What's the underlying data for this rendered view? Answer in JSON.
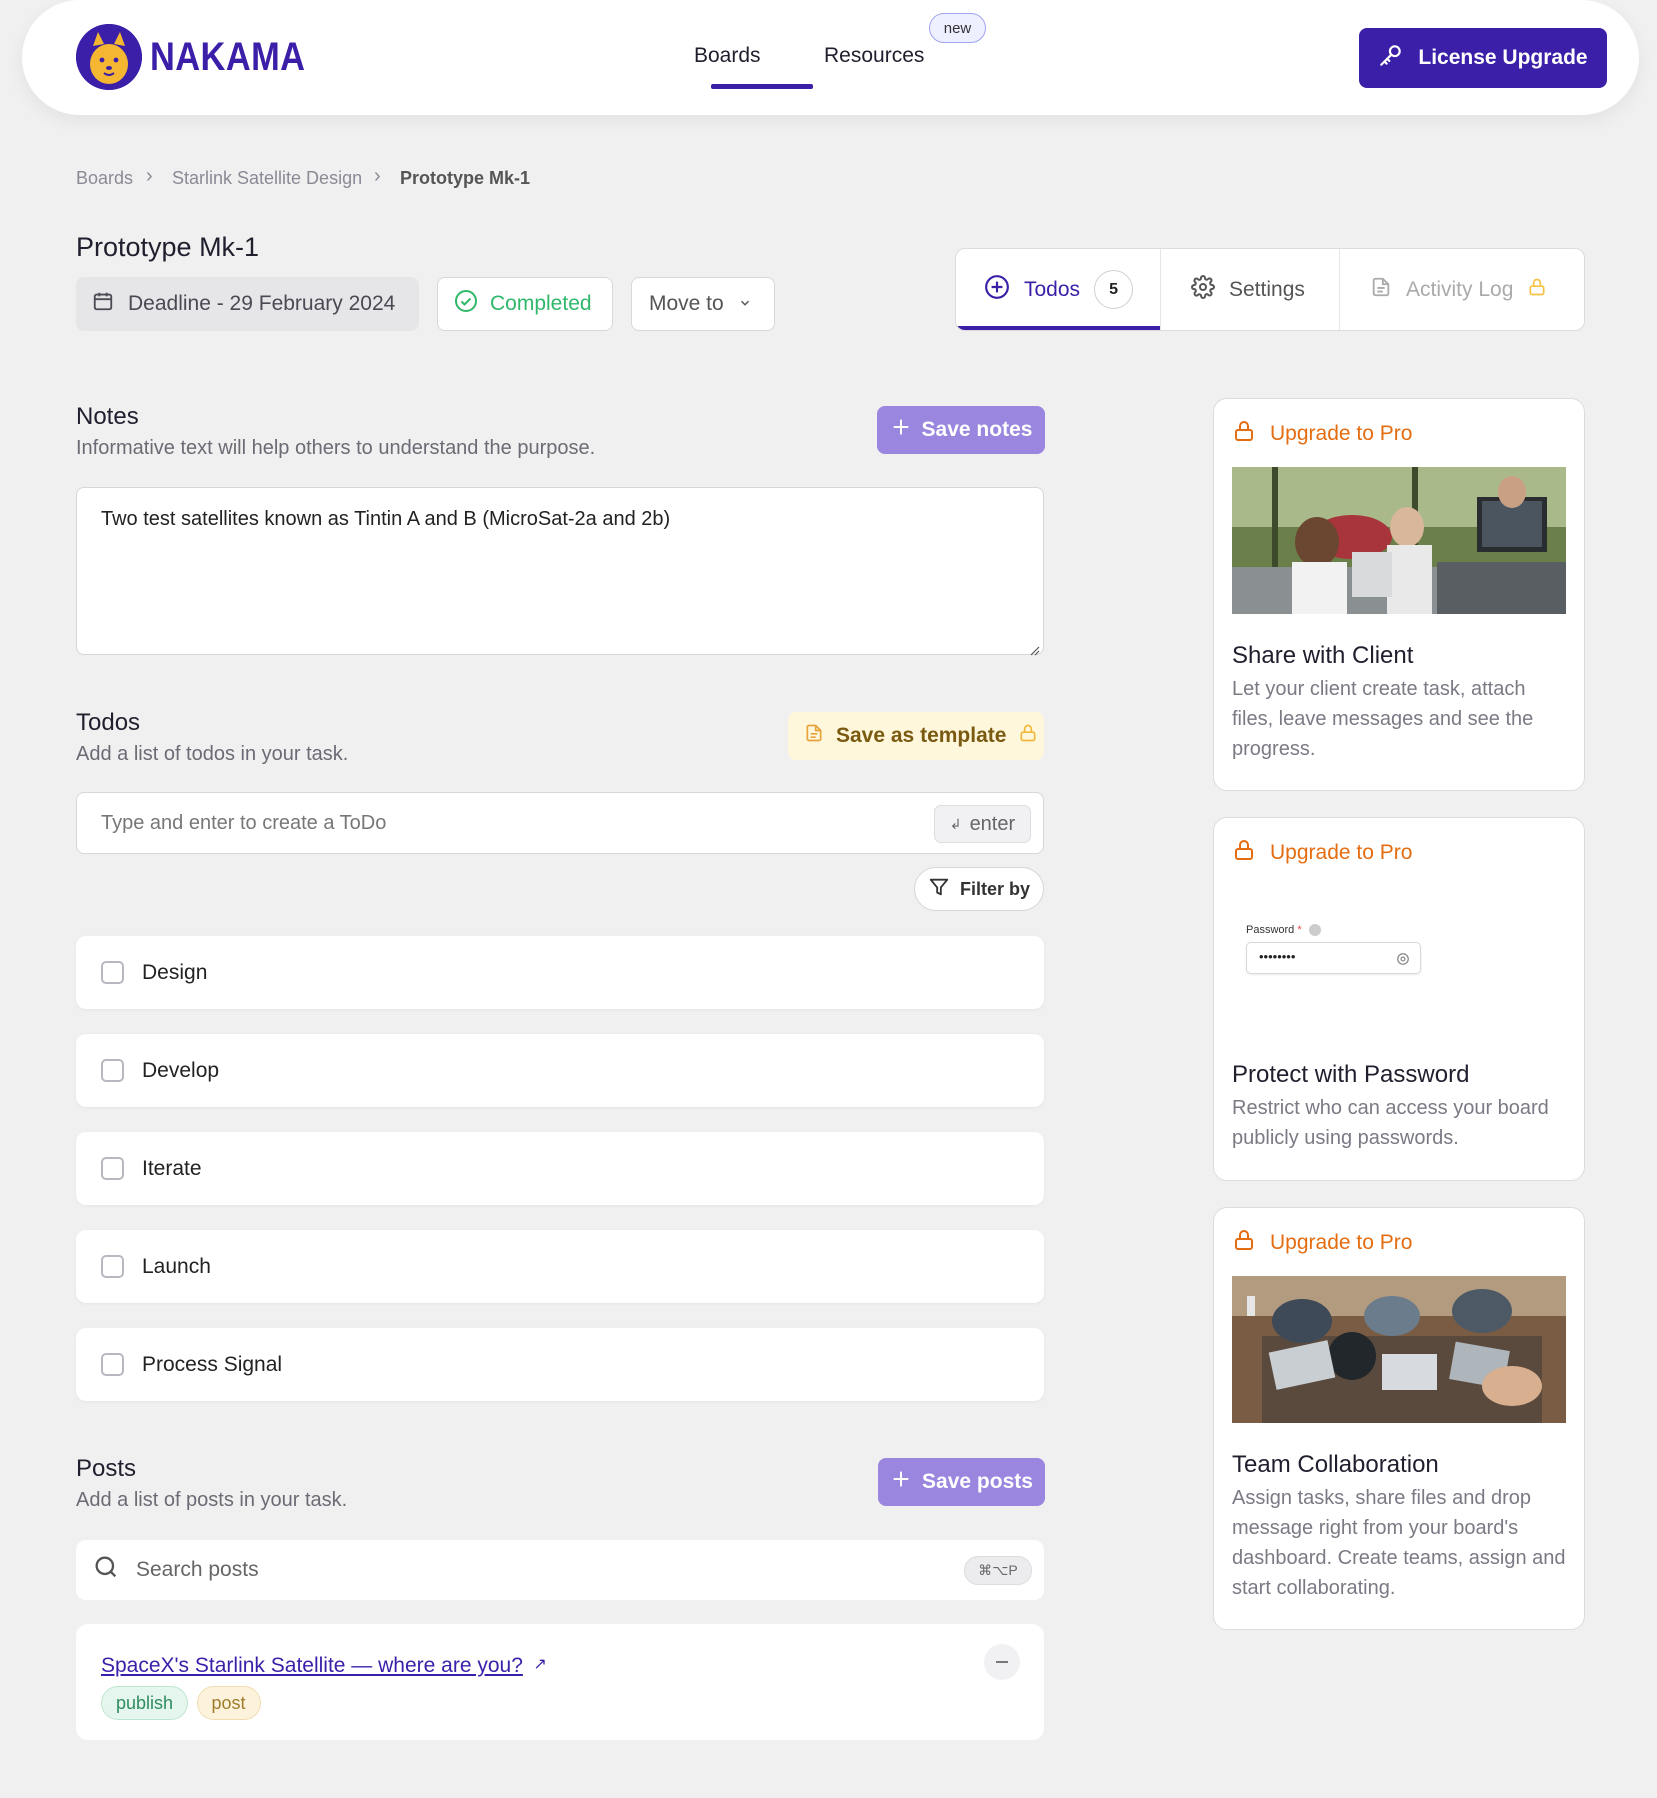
{
  "header": {
    "logo_text": "NAKAMA",
    "nav": {
      "boards": "Boards",
      "resources": "Resources",
      "new_badge": "new"
    },
    "license_button": "License Upgrade"
  },
  "breadcrumb": {
    "items": [
      "Boards",
      "Starlink Satellite Design",
      "Prototype Mk-1"
    ]
  },
  "page": {
    "title": "Prototype Mk-1",
    "deadline": "Deadline - 29 February 2024",
    "status": "Completed",
    "move_to": "Move to"
  },
  "tabs": {
    "todos": "Todos",
    "todos_count": "5",
    "settings": "Settings",
    "activity": "Activity Log"
  },
  "notes": {
    "title": "Notes",
    "subtitle": "Informative text will help others to understand the purpose.",
    "save_label": "Save notes",
    "content": "Two test satellites known as Tintin A and B (MicroSat-2a and 2b)"
  },
  "todos": {
    "title": "Todos",
    "subtitle": "Add a list of todos in your task.",
    "template_label": "Save as template",
    "input_placeholder": "Type and enter to create a ToDo",
    "enter_key": "enter",
    "filter_label": "Filter by",
    "items": [
      {
        "label": "Design",
        "checked": false
      },
      {
        "label": "Develop",
        "checked": false
      },
      {
        "label": "Iterate",
        "checked": false
      },
      {
        "label": "Launch",
        "checked": false
      },
      {
        "label": "Process Signal",
        "checked": false
      }
    ]
  },
  "posts": {
    "title": "Posts",
    "subtitle": "Add a list of posts in your task.",
    "save_label": "Save posts",
    "search_placeholder": "Search posts",
    "search_shortcut": "⌘⌥P",
    "items": [
      {
        "title": "SpaceX's Starlink Satellite — where are you?",
        "tags": [
          "publish",
          "post"
        ]
      }
    ]
  },
  "promos": [
    {
      "badge": "Upgrade to Pro",
      "title": "Share with Client",
      "text": "Let your client create task, attach files, leave messages and see the progress."
    },
    {
      "badge": "Upgrade to Pro",
      "title": "Protect with Password",
      "text": "Restrict who can access your board publicly using passwords.",
      "field_label": "Password",
      "field_value": "••••••••"
    },
    {
      "badge": "Upgrade to Pro",
      "title": "Team Collaboration",
      "text": "Assign tasks, share files and drop message right from your board's dashboard. Create teams, assign and start collaborating."
    }
  ],
  "colors": {
    "brand": "#3b1fa8",
    "accent_orange": "#e46d12",
    "success": "#2fb86a",
    "button_soft": "#9a86de"
  }
}
